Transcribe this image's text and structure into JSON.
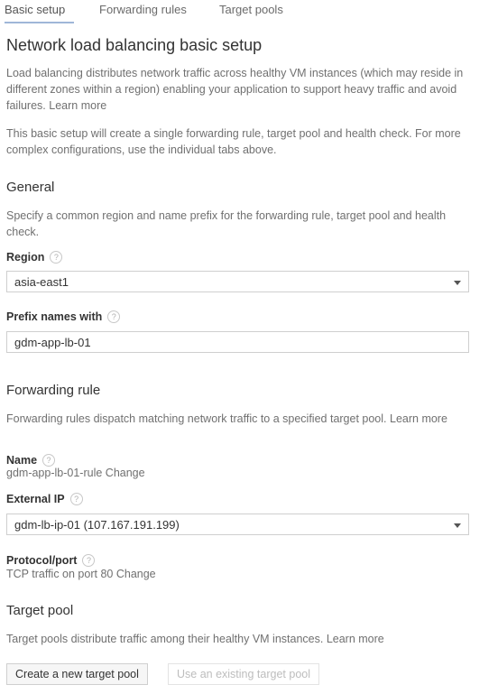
{
  "tabs": [
    {
      "label": "Basic setup"
    },
    {
      "label": "Forwarding rules"
    },
    {
      "label": "Target pools"
    }
  ],
  "page_title": "Network load balancing basic setup",
  "intro": {
    "description_1": "Load balancing distributes network traffic across healthy VM instances (which may reside in different zones within a region) enabling your application to support heavy traffic and avoid failures.",
    "learn_more": "Learn more",
    "description_2": "This basic setup will create a single forwarding rule, target pool and health check. For more complex configurations, use the individual tabs above."
  },
  "general": {
    "heading": "General",
    "description": "Specify a common region and name prefix for the forwarding rule, target pool and health check.",
    "region_label": "Region",
    "region_value": "asia-east1",
    "prefix_label": "Prefix names with",
    "prefix_value": "gdm-app-lb-01"
  },
  "forwarding_rule": {
    "heading": "Forwarding rule",
    "description": "Forwarding rules dispatch matching network traffic to a specified target pool.",
    "learn_more": "Learn more",
    "name_label": "Name",
    "name_value": "gdm-app-lb-01-rule",
    "name_change": "Change",
    "external_ip_label": "External IP",
    "external_ip_value": "gdm-lb-ip-01 (107.167.191.199)",
    "protocol_label": "Protocol/port",
    "protocol_value": "TCP traffic on port 80",
    "protocol_change": "Change"
  },
  "target_pool": {
    "heading": "Target pool",
    "description": "Target pools distribute traffic among their healthy VM instances.",
    "learn_more": "Learn more",
    "create_button": "Create a new target pool",
    "existing_button": "Use an existing target pool"
  },
  "help_icon": "?",
  "colors": {
    "tab_underline": "#9fb6d8",
    "heading": "#333333",
    "body_text": "#707070"
  }
}
